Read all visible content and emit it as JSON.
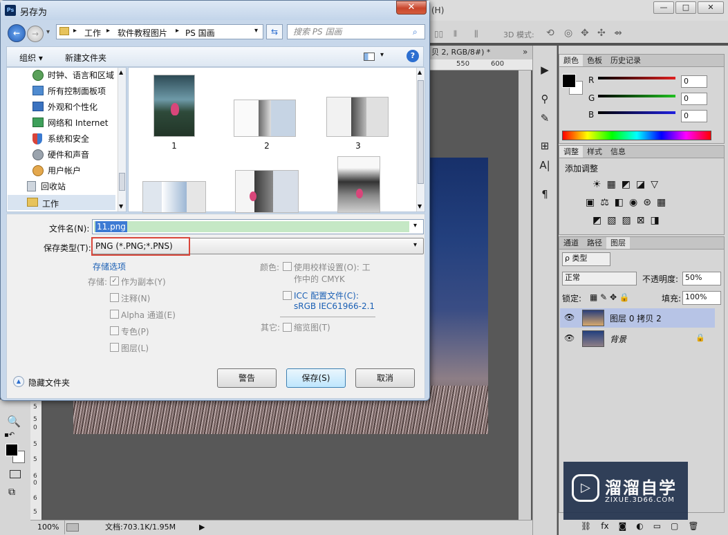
{
  "photoshop": {
    "title_fragment": "(H)",
    "window_controls": [
      "—",
      "□",
      "✕"
    ],
    "options_bar": {
      "mode_label": "3D 模式:"
    },
    "doc_tab": "贝 2, RGB/8#) *",
    "ruler_top": [
      "550",
      "600"
    ],
    "ruler_left": [
      "5",
      "5",
      "0",
      "5",
      "5",
      "6",
      "0",
      "6",
      "5"
    ],
    "status": {
      "zoom": "100%",
      "doc_info": "文档:703.1K/1.95M"
    },
    "color_panel": {
      "tabs": [
        "颜色",
        "色板",
        "历史记录"
      ],
      "channels": [
        {
          "label": "R",
          "value": "0",
          "color": "#e02020"
        },
        {
          "label": "G",
          "value": "0",
          "color": "#20c020"
        },
        {
          "label": "B",
          "value": "0",
          "color": "#2020e0"
        }
      ]
    },
    "adjust_panel": {
      "tabs": [
        "调整",
        "样式",
        "信息"
      ],
      "heading": "添加调整"
    },
    "layers_panel": {
      "tabs": [
        "通道",
        "路径",
        "图层"
      ],
      "filter": "ρ 类型",
      "blend_mode": "正常",
      "opacity_label": "不透明度:",
      "opacity": "50%",
      "lock_label": "锁定:",
      "fill_label": "填充:",
      "fill": "100%",
      "layers": [
        {
          "name": "图层 0 拷贝 2",
          "selected": true
        },
        {
          "name": "背景",
          "selected": false
        }
      ]
    },
    "watermark": {
      "title": "溜溜自学",
      "url": "ZIXUE.3D66.COM"
    }
  },
  "dialog": {
    "title": "另存为",
    "close": "✕",
    "breadcrumb": [
      "工作",
      "软件教程图片",
      "PS 国画"
    ],
    "search_placeholder": "搜索 PS 国画",
    "toolbar": {
      "organize": "组织 ▾",
      "new_folder": "新建文件夹"
    },
    "nav_items": [
      {
        "label": "时钟、语言和区域",
        "icon": "clock-icon"
      },
      {
        "label": "所有控制面板项",
        "icon": "control-panel-icon"
      },
      {
        "label": "外观和个性化",
        "icon": "appearance-icon"
      },
      {
        "label": "网络和 Internet",
        "icon": "network-icon"
      },
      {
        "label": "系统和安全",
        "icon": "shield-icon"
      },
      {
        "label": "硬件和声音",
        "icon": "hardware-icon"
      },
      {
        "label": "用户帐户",
        "icon": "users-icon"
      },
      {
        "label": "回收站",
        "icon": "recycle-bin-icon"
      },
      {
        "label": "工作",
        "icon": "folder-icon"
      }
    ],
    "files": [
      "1",
      "2",
      "3"
    ],
    "filename_label": "文件名(N):",
    "filename": "11.png",
    "filetype_label": "保存类型(T):",
    "filetype": "PNG (*.PNG;*.PNS)",
    "save_options_link": "存储选项",
    "save_label": "存储:",
    "save_opts": [
      {
        "label": "作为副本(Y)",
        "checked": true
      },
      {
        "label": "注释(N)",
        "checked": false
      },
      {
        "label": "Alpha 通道(E)",
        "checked": false
      },
      {
        "label": "专色(P)",
        "checked": false
      },
      {
        "label": "图层(L)",
        "checked": false
      }
    ],
    "color_label": "颜色:",
    "proof_setup": "使用校样设置(O): 工",
    "proof_setup2": "作中的 CMYK",
    "icc_label": "ICC 配置文件(C):",
    "icc_value": "sRGB IEC61966-2.1",
    "other_label": "其它:",
    "thumbnail": "缩览图(T)",
    "hide_folders": "隐藏文件夹",
    "buttons": {
      "warning": "警告",
      "save": "保存(S)",
      "cancel": "取消"
    },
    "highlight_color": "#d9463a"
  }
}
